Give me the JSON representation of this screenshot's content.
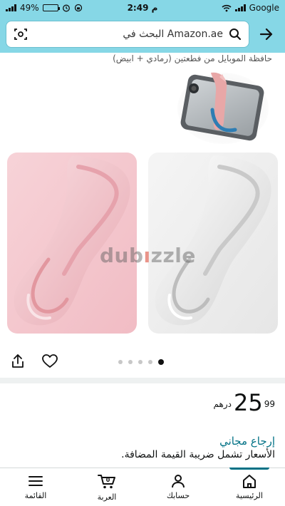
{
  "status_bar": {
    "battery": "49%",
    "battery_level": 0.49,
    "time": "2:49 م",
    "carrier": "Google"
  },
  "header": {
    "search_placeholder": "البحث في Amazon.ae"
  },
  "product": {
    "title_fragment": "حافظة الموبايل من فطعتين (رمادي + ابيض)",
    "watermark": "dubizzle",
    "carousel": {
      "total": 5,
      "active_index": 4
    },
    "price": {
      "whole": "25",
      "fraction": "99",
      "currency": "درهم"
    },
    "returns": "إرجاع مجاني",
    "vat_note": ".الأسعار تشمل ضريبة القيمة المضافة"
  },
  "bottom_nav": {
    "items": [
      {
        "label": "القائمة",
        "icon": "menu-icon"
      },
      {
        "label": "العربة",
        "icon": "cart-icon",
        "badge": "0"
      },
      {
        "label": "حسابك",
        "icon": "person-icon"
      },
      {
        "label": "الرئيسية",
        "icon": "home-icon"
      }
    ]
  },
  "colors": {
    "header_bg": "#86d7e6",
    "link": "#007185",
    "pink_case": "#f4c9cf",
    "white_case": "#f2f2f2"
  }
}
